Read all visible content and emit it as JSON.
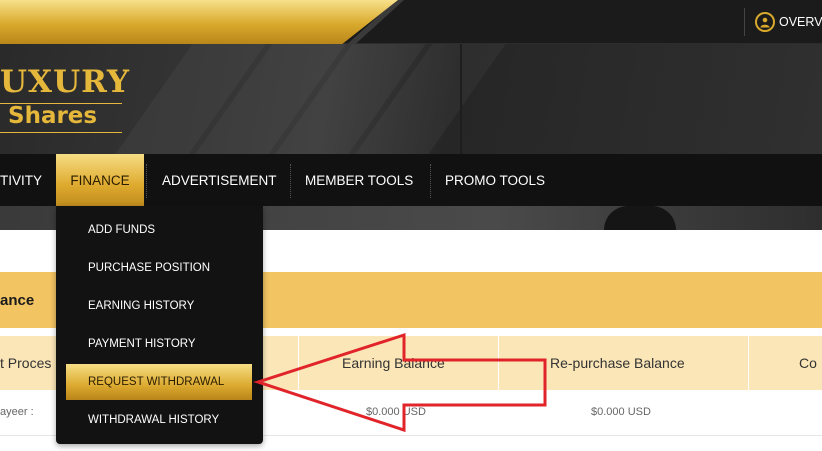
{
  "topbar": {
    "overview_label": "OVERVI"
  },
  "logo": {
    "line1": "UXURY",
    "line2": "Shares"
  },
  "nav": {
    "items": [
      {
        "label": "TIVITY"
      },
      {
        "label": "FINANCE"
      },
      {
        "label": "ADVERTISEMENT"
      },
      {
        "label": "MEMBER TOOLS"
      },
      {
        "label": "PROMO TOOLS"
      }
    ]
  },
  "dropdown": {
    "items": [
      {
        "label": "ADD FUNDS"
      },
      {
        "label": "PURCHASE POSITION"
      },
      {
        "label": "EARNING HISTORY"
      },
      {
        "label": "PAYMENT HISTORY"
      },
      {
        "label": "REQUEST WITHDRAWAL"
      },
      {
        "label": "WITHDRAWAL HISTORY"
      }
    ]
  },
  "content": {
    "section_title": "ance",
    "table": {
      "headers": [
        "t Proces",
        "Earning Balance",
        "Re-purchase Balance",
        "Co"
      ],
      "row": {
        "label": "ayeer :",
        "earning": "$0.000 USD",
        "repurchase": "$0.000 USD"
      }
    }
  },
  "colors": {
    "gold": "#e5b73b",
    "gold_header": "#f2c462",
    "table_head": "#fbe6b7",
    "annotation": "#e0242a",
    "nav_bg": "#111111"
  }
}
